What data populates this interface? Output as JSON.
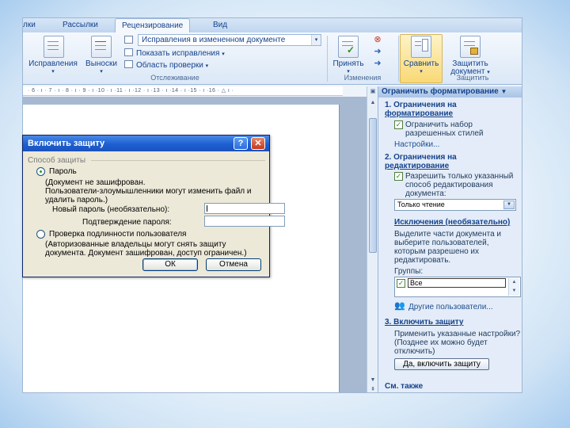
{
  "tabs": [
    {
      "label": "лки"
    },
    {
      "label": "Рассылки"
    },
    {
      "label": "Рецензирование",
      "active": true
    },
    {
      "label": "Вид"
    }
  ],
  "ribbon": {
    "corrections_label": "Исправления",
    "balloons_label": "Выноски",
    "display_combo": "Исправления в измененном документе",
    "show_markup": "Показать исправления",
    "review_pane": "Область проверки",
    "tracking_group": "Отслеживание",
    "accept_label": "Принять",
    "changes_group": "Изменения",
    "compare_label": "Сравнить",
    "protect_label_1": "Защитить",
    "protect_label_2": "документ",
    "protect_group": "Защитить"
  },
  "ruler_text": "· 6 · ı · 7 · ı · 8 · ı · 9 · ı ·10 · ı ·11 · ı ·12 · ı ·13 · ı ·14 · ı ·15 · ı ·16 · △ ı ·",
  "dialog": {
    "title": "Включить защиту",
    "group_label": "Способ защиты",
    "option_password": "Пароль",
    "password_note_1": "(Документ не зашифрован.",
    "password_note_2": "Пользователи-злоумышленники могут изменить файл и",
    "password_note_3": "удалить пароль.)",
    "new_password_label": "Новый пароль (необязательно):",
    "confirm_password_label": "Подтверждение пароля:",
    "option_auth": "Проверка подлинности пользователя",
    "auth_note_1": "(Авторизованные владельцы могут снять защиту",
    "auth_note_2": "документа. Документ зашифрован, доступ ограничен.)",
    "ok_label": "ОК",
    "cancel_label": "Отмена"
  },
  "pane": {
    "title": "Ограничить форматирование",
    "section1_title_1": "1. Ограничения на",
    "section1_title_2": "форматирование",
    "limit_formatting_1": "Ограничить набор",
    "limit_formatting_2": "разрешенных стилей",
    "settings_link": "Настройки...",
    "section2_title_1": "2. Ограничения на",
    "section2_title_2": "редактирование",
    "allow_only_1": "Разрешить только указанный",
    "allow_only_2": "способ редактирования",
    "allow_only_3": "документа:",
    "edit_mode": "Только чтение",
    "exceptions_title": "Исключения (необязательно)",
    "exceptions_text_1": "Выделите части документа и",
    "exceptions_text_2": "выберите пользователей,",
    "exceptions_text_3": "которым разрешено их",
    "exceptions_text_4": "редактировать.",
    "groups_label": "Группы:",
    "group_everyone": "Все",
    "other_users": "Другие пользователи...",
    "section3_title": "3. Включить защиту",
    "section3_text_1": "Применить указанные настройки?",
    "section3_text_2": "(Позднее их можно будет",
    "section3_text_3": "отключить)",
    "enable_button": "Да, включить защиту",
    "see_also": "См. также"
  }
}
